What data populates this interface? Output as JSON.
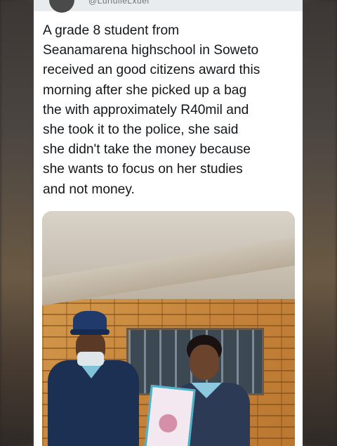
{
  "post": {
    "handle": "@LuriulleLxuel",
    "text": "A grade 8 student from\nSeanamarena highschool in Soweto\nreceived an good citizens award this\nmorning after she picked up a bag\nthe with approximately R40mil and\nshe took it to the police, she said\nshe didn't take the money because\nshe wants to focus on her studies\nand not money."
  },
  "icons": {
    "avatar": "avatar-icon"
  },
  "colors": {
    "card_bg": "#ffffff",
    "text": "#14171a",
    "handle": "#6b7178"
  }
}
